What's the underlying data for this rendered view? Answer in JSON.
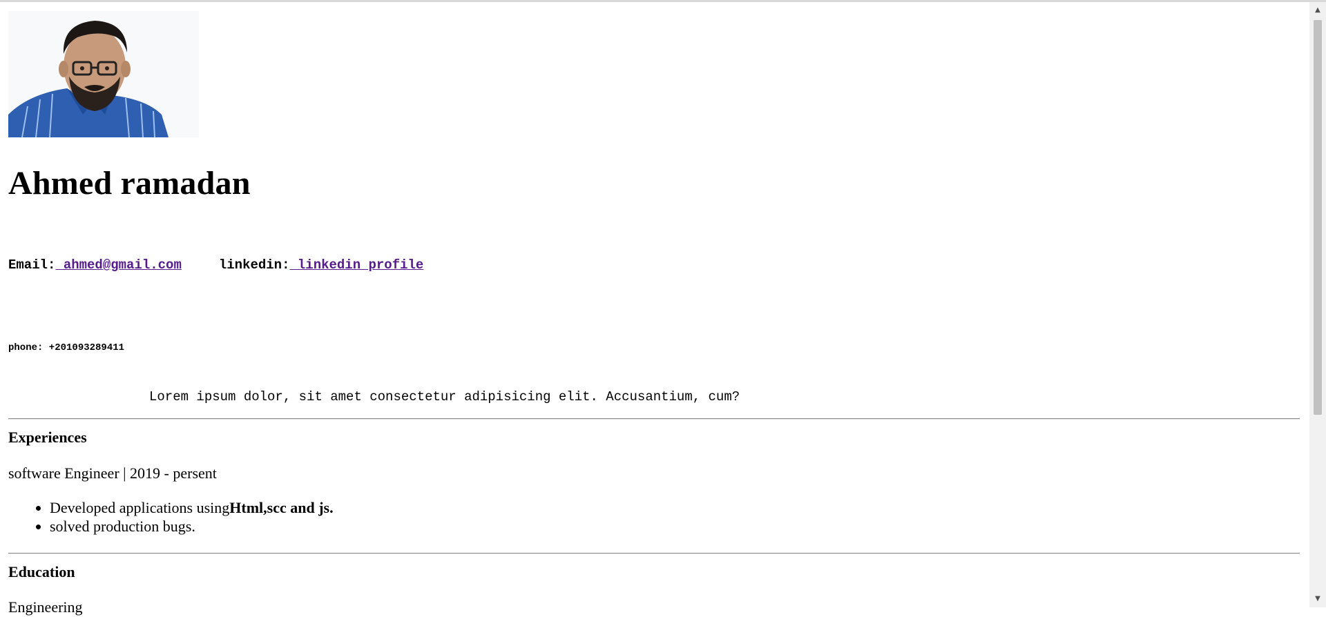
{
  "profile": {
    "name": "Ahmed ramadan",
    "photo_icon": "person-portrait"
  },
  "contact": {
    "email_label": "Email:",
    "email_value": " ahmed@gmail.com",
    "linkedin_label": "linkedin:",
    "linkedin_value": " linkedin profile",
    "phone": "phone: +201093289411"
  },
  "summary": "Lorem ipsum dolor, sit amet consectetur adipisicing elit. Accusantium, cum?",
  "experiences": {
    "heading": "Experiences",
    "role": "software Engineer | 2019 - persent",
    "duties": [
      {
        "text": "Developed applications using",
        "bold": "Html,scc and js."
      },
      {
        "text": "solved production bugs.",
        "bold": ""
      }
    ]
  },
  "education": {
    "heading": "Education",
    "degree": "Engineering"
  },
  "colors": {
    "link": "#551a8b",
    "divider": "#8c8c8c",
    "scrollbar_thumb": "#c1c1c1"
  },
  "icons": {
    "scroll_up": "triangle-up-icon",
    "scroll_down": "triangle-down-icon"
  }
}
